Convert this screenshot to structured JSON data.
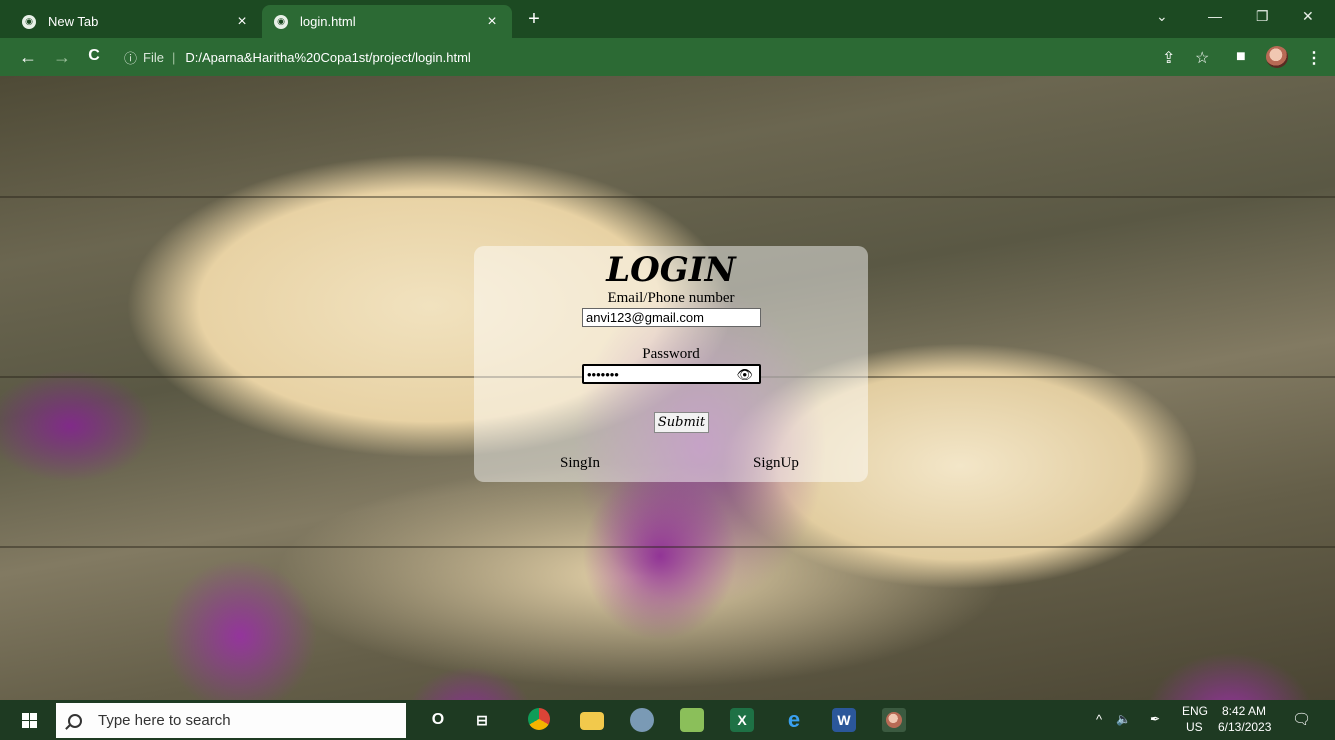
{
  "browser": {
    "tabs": [
      {
        "title": "New Tab",
        "close": "×"
      },
      {
        "title": "login.html",
        "close": "×"
      }
    ],
    "new_tab": "+",
    "window": {
      "dropdown": "⌄",
      "minimize": "—",
      "restore": "❐",
      "close": "✕"
    },
    "nav": {
      "back": "←",
      "forward": "→",
      "reload": "C"
    },
    "address": {
      "info": "ⓘ",
      "scheme_label": "File",
      "separator": "|",
      "url": "D:/Aparna&Haritha%20Copa1st/project/login.html"
    },
    "toolbar_icons": {
      "share": "⇪",
      "bookmark": "☆",
      "sidepanel": "■",
      "menu": "⋮"
    }
  },
  "login": {
    "title": "LOGIN",
    "email_label": "Email/Phone number",
    "email_value": "anvi123@gmail.com",
    "password_label": "Password",
    "password_value": "•••••••",
    "eye_icon": "👁",
    "submit_label": "Submit",
    "signin_label": "SingIn",
    "signup_label": "SignUp"
  },
  "taskbar": {
    "search_placeholder": "Type here to search",
    "apps": {
      "cortana": "O",
      "taskview": "⊟",
      "excel": "X",
      "edge": "e",
      "word": "W"
    },
    "tray": {
      "chevron": "^",
      "volume": "🔈",
      "pen": "✒",
      "lang_top": "ENG",
      "lang_bottom": "US",
      "time": "8:42 AM",
      "date": "6/13/2023",
      "notifications": "🗨"
    }
  },
  "colors": {
    "chrome_frame": "#1c4a22",
    "chrome_toolbar": "#2c6a34",
    "taskbar": "#1e3a22",
    "card_overlay": "rgba(255,255,255,0.47)"
  }
}
